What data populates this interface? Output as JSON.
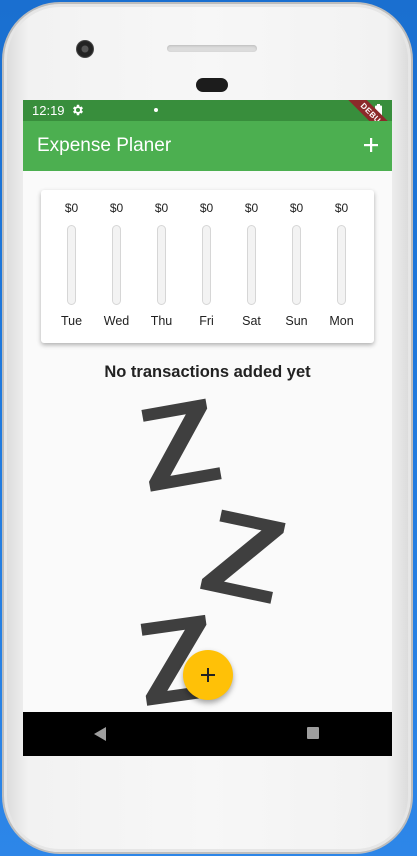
{
  "status_bar": {
    "time": "12:19"
  },
  "debug_banner": "DEBUG",
  "app_bar": {
    "title": "Expense Planer",
    "add_icon": "plus-icon"
  },
  "chart": {
    "days": [
      {
        "label": "Tue",
        "amount": "$0",
        "fill": 0
      },
      {
        "label": "Wed",
        "amount": "$0",
        "fill": 0
      },
      {
        "label": "Thu",
        "amount": "$0",
        "fill": 0
      },
      {
        "label": "Fri",
        "amount": "$0",
        "fill": 0
      },
      {
        "label": "Sat",
        "amount": "$0",
        "fill": 0
      },
      {
        "label": "Sun",
        "amount": "$0",
        "fill": 0
      },
      {
        "label": "Mon",
        "amount": "$0",
        "fill": 0
      }
    ],
    "bar_color": "#4caf50"
  },
  "empty_state": {
    "message": "No transactions added yet",
    "image_icon": "zzz-sleep-icon"
  },
  "fab": {
    "icon": "plus-icon",
    "color": "#ffc107"
  },
  "colors": {
    "primary": "#4caf50",
    "primary_dark": "#388e3c",
    "accent": "#ffc107"
  }
}
